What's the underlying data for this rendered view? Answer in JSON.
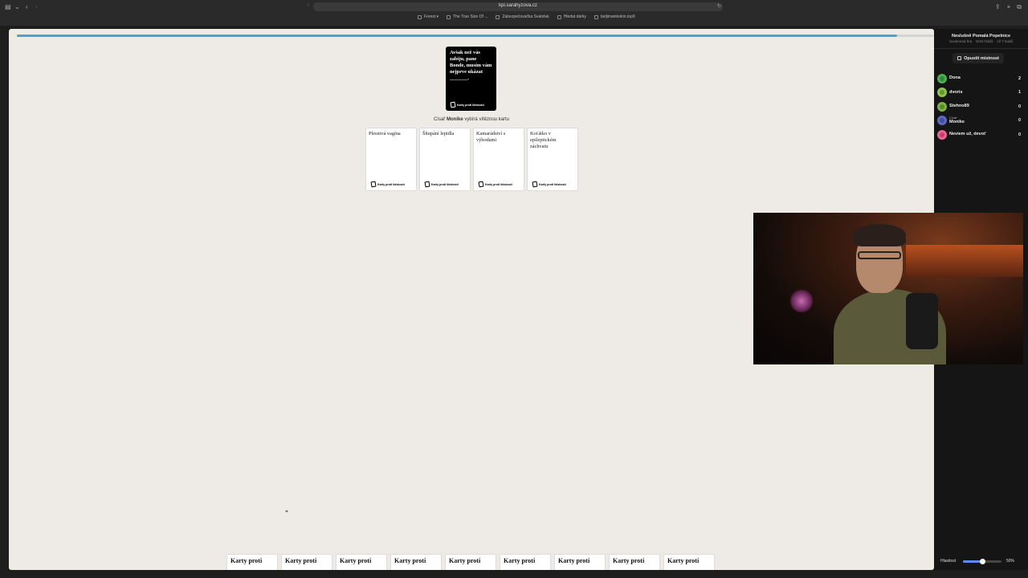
{
  "browser": {
    "url": "kpi.sarahyzova.cz",
    "bookmarks": [
      "Forest ▾",
      "The True Size Of ...",
      "Zabezpečovačka Svatoluk",
      "Hledat dárky",
      "beljimanlookin.top9"
    ]
  },
  "progress": {
    "fraction": 0.96,
    "color": "#4aa3cf"
  },
  "black_card": {
    "text": "Avšak než vás zabiju, pane Bonde, musím vám nejprve ukázat _______.",
    "footer": "Karty proti lidskosti"
  },
  "czar_line": {
    "prefix": "Císař",
    "name": "Monike",
    "suffix": "vybírá vítěznou kartu"
  },
  "white_cards": [
    {
      "text": "Plesnivá vagína",
      "footer": "Karty proti lidskosti"
    },
    {
      "text": "Šňupání lepidla",
      "footer": "Karty proti lidskosti"
    },
    {
      "text": "Kamarádství s výhodami",
      "footer": "Karty proti lidskosti"
    },
    {
      "text": "Koťátko v epileptickém záchvatu",
      "footer": "Karty proti lidskosti"
    }
  ],
  "hand": [
    "Karty proti",
    "Karty proti",
    "Karty proti",
    "Karty proti",
    "Karty proti",
    "Karty proti",
    "Karty proti",
    "Karty proti",
    "Karty proti"
  ],
  "sidebar": {
    "room_name": "Neslušně Pomalá Popelnice",
    "meta": [
      "Soukromá hra",
      "5/10 hráčů",
      "cíl 7 bodů"
    ],
    "leave_label": "Opustit místnost",
    "players": [
      {
        "role": "",
        "name": "Dona",
        "score": "2",
        "color": "#4caf50"
      },
      {
        "role": "",
        "name": "dvoris",
        "score": "1",
        "color": "#8bc34a"
      },
      {
        "role": "",
        "name": "Stehno89",
        "score": "0",
        "color": "#7cb342"
      },
      {
        "role": "Císař",
        "name": "Monike",
        "score": "0",
        "color": "#5c6bc0"
      },
      {
        "role": "",
        "name": "Neviem už, devoť",
        "score": "0",
        "color": "#f06292"
      }
    ],
    "volume_label": "Hlasitost",
    "volume_value": "50%",
    "volume_fraction": 0.5
  }
}
